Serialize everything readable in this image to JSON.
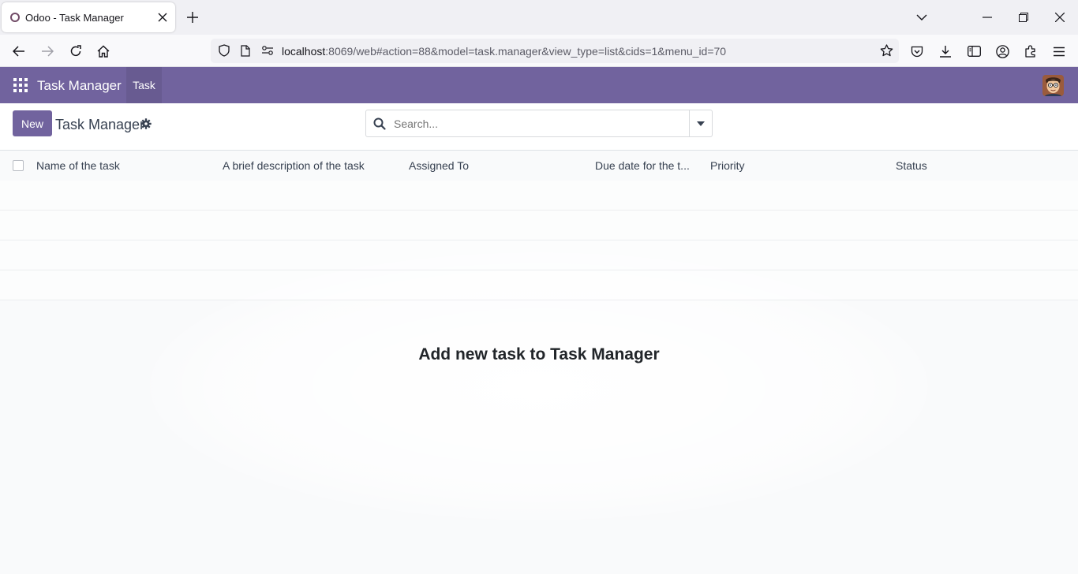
{
  "browser": {
    "tab_title": "Odoo - Task Manager",
    "url_host": "localhost",
    "url_rest": ":8069/web#action=88&model=task.manager&view_type=list&cids=1&menu_id=70"
  },
  "odoo": {
    "app_name": "Task Manager",
    "menu": {
      "task": "Task"
    }
  },
  "control_panel": {
    "new_label": "New",
    "breadcrumb": "Task Manager",
    "search_placeholder": "Search..."
  },
  "list": {
    "columns": [
      "Name of the task",
      "A brief description of the task",
      "Assigned To",
      "Due date for the t...",
      "Priority",
      "Status"
    ],
    "empty_helper": "Add new task to Task Manager"
  },
  "colors": {
    "odoo_primary": "#71639e",
    "brand_favicon": "#714b67"
  }
}
